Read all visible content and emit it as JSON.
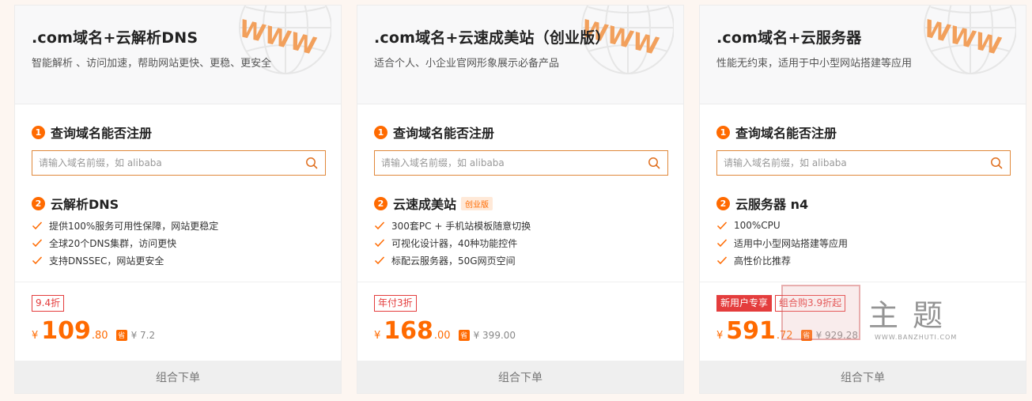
{
  "cards": [
    {
      "title": ".com域名+云解析DNS",
      "subtitle": "智能解析 、访问加速，帮助网站更快、更稳、更安全",
      "globe_text": "WWW",
      "step1_label": "查询域名能否注册",
      "search_placeholder": "请输入域名前缀，如 alibaba",
      "step2_label": "云解析DNS",
      "step2_tag": "",
      "features": [
        "提供100%服务可用性保障，网站更稳定",
        "全球20个DNS集群，访问更快",
        "支持DNSSEC，网站更安全"
      ],
      "badges": [
        {
          "text": "9.4折",
          "style": "outline"
        }
      ],
      "currency": "¥",
      "price_int": "109",
      "price_dec": ".80",
      "save_icon": "省",
      "original": "¥ 7.2",
      "order_label": "组合下单"
    },
    {
      "title": ".com域名+云速成美站（创业版）",
      "subtitle": "适合个人、小企业官网形象展示必备产品",
      "globe_text": "WWW",
      "step1_label": "查询域名能否注册",
      "search_placeholder": "请输入域名前缀，如 alibaba",
      "step2_label": "云速成美站",
      "step2_tag": "创业版",
      "features": [
        "300套PC + 手机站模板随意切换",
        "可视化设计器，40种功能控件",
        "标配云服务器，50G网页空间"
      ],
      "badges": [
        {
          "text": "年付3折",
          "style": "outline"
        }
      ],
      "currency": "¥",
      "price_int": "168",
      "price_dec": ".00",
      "save_icon": "省",
      "original": "¥ 399.00",
      "order_label": "组合下单"
    },
    {
      "title": ".com域名+云服务器",
      "subtitle": "性能无约束，适用于中小型网站搭建等应用",
      "globe_text": "WWW",
      "step1_label": "查询域名能否注册",
      "search_placeholder": "请输入域名前缀，如 alibaba",
      "step2_label": "云服务器 n4",
      "step2_tag": "",
      "features": [
        "100%CPU",
        "适用中小型网站搭建等应用",
        "高性价比推荐"
      ],
      "badges": [
        {
          "text": "新用户专享",
          "style": "solid"
        },
        {
          "text": "组合购3.9折起",
          "style": "outline"
        }
      ],
      "currency": "¥",
      "price_int": "591",
      "price_dec": ".72",
      "save_icon": "省",
      "original": "¥ 929.28",
      "order_label": "组合下单"
    }
  ],
  "watermark": {
    "text": "主题",
    "url": "WWW.BANZHUTI.COM"
  },
  "colors": {
    "accent": "#ff6a00",
    "badge_red": "#e43d3d",
    "input_border": "#e0883a"
  }
}
